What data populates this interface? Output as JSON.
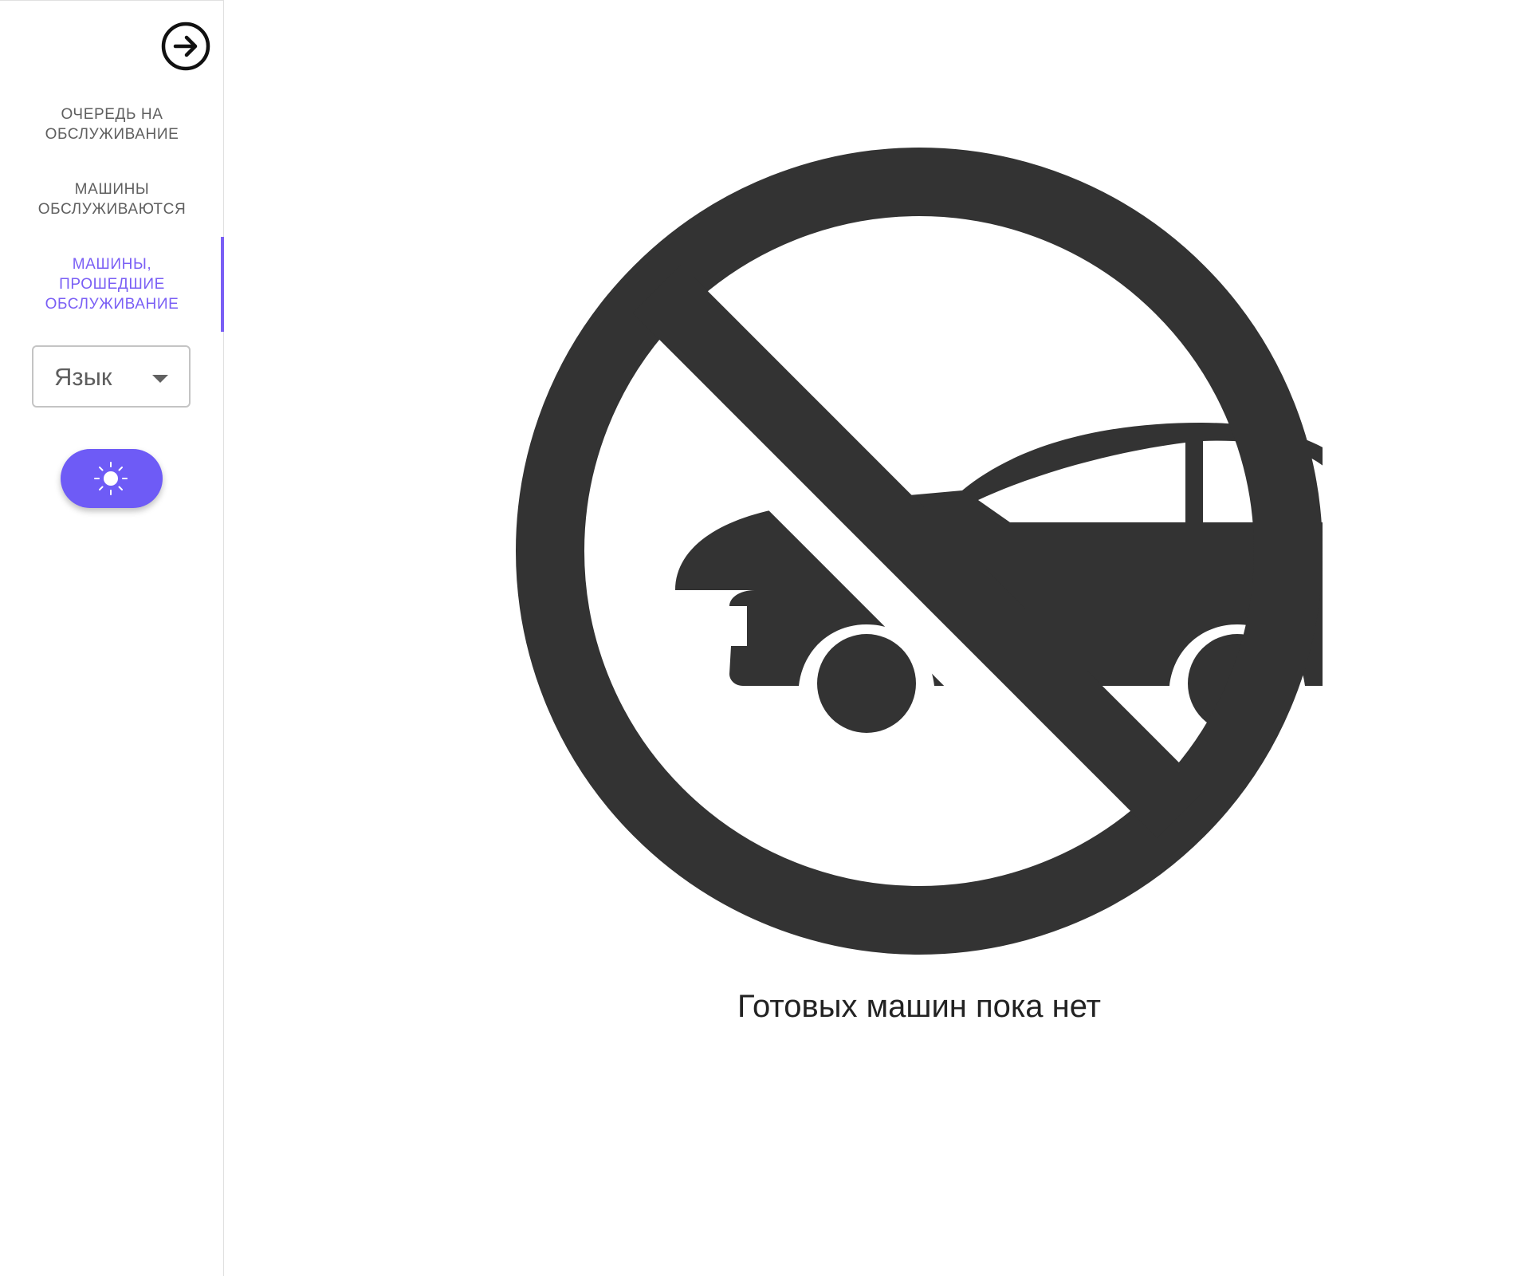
{
  "sidebar": {
    "collapse_icon": "arrow-right-circle-icon",
    "items": [
      {
        "label": "ОЧЕРЕДЬ НА ОБСЛУЖИВАНИЕ",
        "active": false
      },
      {
        "label": "МАШИНЫ ОБСЛУЖИВАЮТСЯ",
        "active": false
      },
      {
        "label": "МАШИНЫ, ПРОШЕДШИЕ ОБСЛУЖИВАНИЕ",
        "active": true
      }
    ],
    "language_select": {
      "label": "Язык"
    },
    "theme_toggle_icon": "sun-icon"
  },
  "main": {
    "illustration_icon": "no-cars-icon",
    "empty_message": "Готовых машин пока нет"
  },
  "colors": {
    "accent": "#6e5bf6",
    "active_text": "#7a5ff5",
    "icon_dark": "#333333"
  }
}
